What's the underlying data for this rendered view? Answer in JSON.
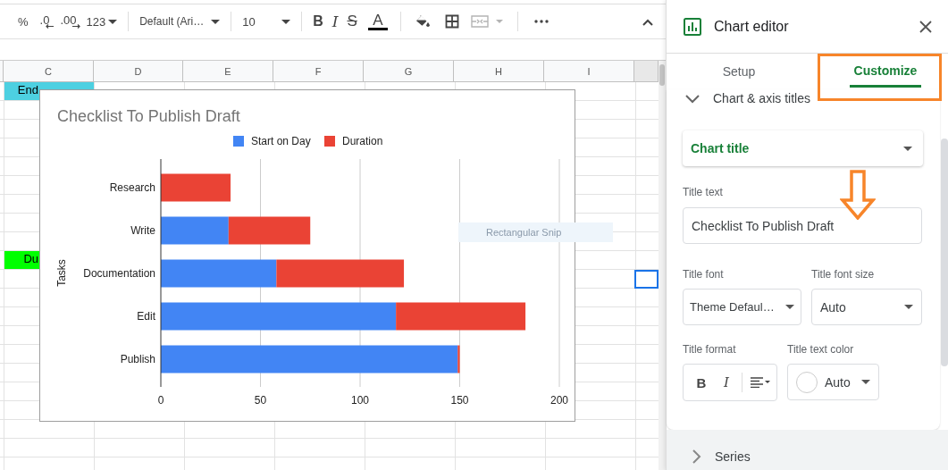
{
  "toolbar": {
    "items": [
      {
        "kind": "percent",
        "label": "%",
        "disabled": false
      },
      {
        "kind": "decimal-less",
        "label": ".0",
        "disabled": false
      },
      {
        "kind": "decimal-more",
        "label": ".00",
        "disabled": false
      },
      {
        "kind": "format",
        "label": "123",
        "disabled": false
      },
      {
        "kind": "sep"
      },
      {
        "kind": "font",
        "label": "Default (Ari…",
        "disabled": false
      },
      {
        "kind": "sep"
      },
      {
        "kind": "size",
        "label": "10",
        "disabled": false
      },
      {
        "kind": "sep"
      },
      {
        "kind": "bold",
        "label": "B",
        "disabled": false
      },
      {
        "kind": "italic",
        "label": "I",
        "disabled": false
      },
      {
        "kind": "strike",
        "label": "S",
        "disabled": false
      },
      {
        "kind": "text-color",
        "label": "A",
        "disabled": false
      },
      {
        "kind": "sep"
      },
      {
        "kind": "fill",
        "disabled": false
      },
      {
        "kind": "borders",
        "disabled": false
      },
      {
        "kind": "merge",
        "disabled": true
      },
      {
        "kind": "sep"
      },
      {
        "kind": "more",
        "disabled": false
      }
    ]
  },
  "sheet": {
    "columns": [
      "C",
      "D",
      "E",
      "F",
      "G",
      "H",
      "I"
    ],
    "cells": [
      {
        "text": "End",
        "color": "#4dd0e1"
      },
      {
        "text": "Du",
        "color": "#00ff00"
      }
    ],
    "cursor_visible": true,
    "tooltip": "Rectangular Snip"
  },
  "chart": {
    "chart_data": {
      "type": "bar",
      "orientation": "horizontal",
      "stacked": true,
      "title": "Checklist To Publish Draft",
      "ylabel": "Tasks",
      "categories": [
        "Research",
        "Write",
        "Documentation",
        "Edit",
        "Publish"
      ],
      "series": [
        {
          "name": "Start on Day",
          "color": "#4285f4",
          "values": [
            0,
            34,
            58,
            118,
            149
          ]
        },
        {
          "name": "Duration",
          "color": "#ea4335",
          "values": [
            35,
            41,
            64,
            65,
            1
          ]
        }
      ],
      "xlim": [
        0,
        200
      ],
      "xticks": [
        0,
        50,
        100,
        150,
        200
      ],
      "grid": true,
      "legend": true
    }
  },
  "editor": {
    "title": "Chart editor",
    "tabs": [
      {
        "label": "Setup",
        "selected": false
      },
      {
        "label": "Customize",
        "selected": true
      }
    ],
    "section": {
      "label": "Chart & axis titles",
      "expanded": true
    },
    "target": "Chart title",
    "title_text": {
      "label": "Title text",
      "value": "Checklist To Publish Draft"
    },
    "title_font": {
      "label": "Title font",
      "value": "Theme Defaul…"
    },
    "title_font_size": {
      "label": "Title font size",
      "value": "Auto"
    },
    "title_format": {
      "label": "Title format",
      "bold": "B",
      "italic": "I"
    },
    "title_text_color": {
      "label": "Title text color",
      "value": "Auto"
    },
    "next_section": {
      "label": "Series",
      "expanded": false
    }
  }
}
